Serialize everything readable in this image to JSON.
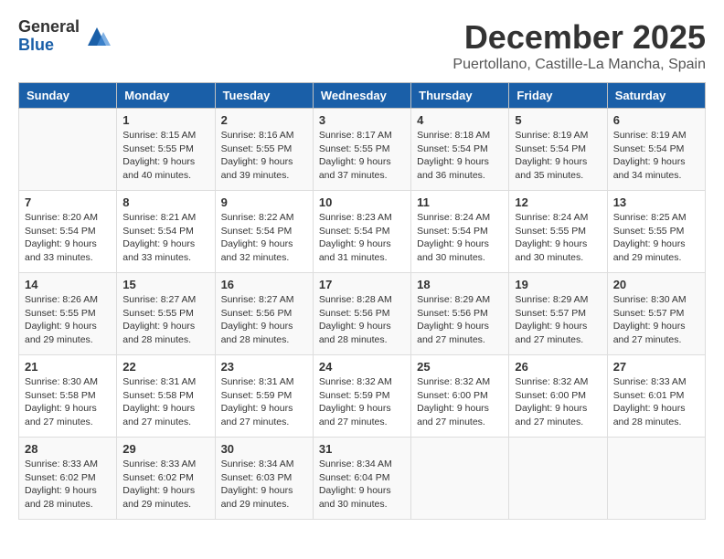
{
  "logo": {
    "general": "General",
    "blue": "Blue"
  },
  "title": "December 2025",
  "location": "Puertollano, Castille-La Mancha, Spain",
  "weekdays": [
    "Sunday",
    "Monday",
    "Tuesday",
    "Wednesday",
    "Thursday",
    "Friday",
    "Saturday"
  ],
  "weeks": [
    [
      {
        "day": "",
        "info": ""
      },
      {
        "day": "1",
        "info": "Sunrise: 8:15 AM\nSunset: 5:55 PM\nDaylight: 9 hours\nand 40 minutes."
      },
      {
        "day": "2",
        "info": "Sunrise: 8:16 AM\nSunset: 5:55 PM\nDaylight: 9 hours\nand 39 minutes."
      },
      {
        "day": "3",
        "info": "Sunrise: 8:17 AM\nSunset: 5:55 PM\nDaylight: 9 hours\nand 37 minutes."
      },
      {
        "day": "4",
        "info": "Sunrise: 8:18 AM\nSunset: 5:54 PM\nDaylight: 9 hours\nand 36 minutes."
      },
      {
        "day": "5",
        "info": "Sunrise: 8:19 AM\nSunset: 5:54 PM\nDaylight: 9 hours\nand 35 minutes."
      },
      {
        "day": "6",
        "info": "Sunrise: 8:19 AM\nSunset: 5:54 PM\nDaylight: 9 hours\nand 34 minutes."
      }
    ],
    [
      {
        "day": "7",
        "info": "Sunrise: 8:20 AM\nSunset: 5:54 PM\nDaylight: 9 hours\nand 33 minutes."
      },
      {
        "day": "8",
        "info": "Sunrise: 8:21 AM\nSunset: 5:54 PM\nDaylight: 9 hours\nand 33 minutes."
      },
      {
        "day": "9",
        "info": "Sunrise: 8:22 AM\nSunset: 5:54 PM\nDaylight: 9 hours\nand 32 minutes."
      },
      {
        "day": "10",
        "info": "Sunrise: 8:23 AM\nSunset: 5:54 PM\nDaylight: 9 hours\nand 31 minutes."
      },
      {
        "day": "11",
        "info": "Sunrise: 8:24 AM\nSunset: 5:54 PM\nDaylight: 9 hours\nand 30 minutes."
      },
      {
        "day": "12",
        "info": "Sunrise: 8:24 AM\nSunset: 5:55 PM\nDaylight: 9 hours\nand 30 minutes."
      },
      {
        "day": "13",
        "info": "Sunrise: 8:25 AM\nSunset: 5:55 PM\nDaylight: 9 hours\nand 29 minutes."
      }
    ],
    [
      {
        "day": "14",
        "info": "Sunrise: 8:26 AM\nSunset: 5:55 PM\nDaylight: 9 hours\nand 29 minutes."
      },
      {
        "day": "15",
        "info": "Sunrise: 8:27 AM\nSunset: 5:55 PM\nDaylight: 9 hours\nand 28 minutes."
      },
      {
        "day": "16",
        "info": "Sunrise: 8:27 AM\nSunset: 5:56 PM\nDaylight: 9 hours\nand 28 minutes."
      },
      {
        "day": "17",
        "info": "Sunrise: 8:28 AM\nSunset: 5:56 PM\nDaylight: 9 hours\nand 28 minutes."
      },
      {
        "day": "18",
        "info": "Sunrise: 8:29 AM\nSunset: 5:56 PM\nDaylight: 9 hours\nand 27 minutes."
      },
      {
        "day": "19",
        "info": "Sunrise: 8:29 AM\nSunset: 5:57 PM\nDaylight: 9 hours\nand 27 minutes."
      },
      {
        "day": "20",
        "info": "Sunrise: 8:30 AM\nSunset: 5:57 PM\nDaylight: 9 hours\nand 27 minutes."
      }
    ],
    [
      {
        "day": "21",
        "info": "Sunrise: 8:30 AM\nSunset: 5:58 PM\nDaylight: 9 hours\nand 27 minutes."
      },
      {
        "day": "22",
        "info": "Sunrise: 8:31 AM\nSunset: 5:58 PM\nDaylight: 9 hours\nand 27 minutes."
      },
      {
        "day": "23",
        "info": "Sunrise: 8:31 AM\nSunset: 5:59 PM\nDaylight: 9 hours\nand 27 minutes."
      },
      {
        "day": "24",
        "info": "Sunrise: 8:32 AM\nSunset: 5:59 PM\nDaylight: 9 hours\nand 27 minutes."
      },
      {
        "day": "25",
        "info": "Sunrise: 8:32 AM\nSunset: 6:00 PM\nDaylight: 9 hours\nand 27 minutes."
      },
      {
        "day": "26",
        "info": "Sunrise: 8:32 AM\nSunset: 6:00 PM\nDaylight: 9 hours\nand 27 minutes."
      },
      {
        "day": "27",
        "info": "Sunrise: 8:33 AM\nSunset: 6:01 PM\nDaylight: 9 hours\nand 28 minutes."
      }
    ],
    [
      {
        "day": "28",
        "info": "Sunrise: 8:33 AM\nSunset: 6:02 PM\nDaylight: 9 hours\nand 28 minutes."
      },
      {
        "day": "29",
        "info": "Sunrise: 8:33 AM\nSunset: 6:02 PM\nDaylight: 9 hours\nand 29 minutes."
      },
      {
        "day": "30",
        "info": "Sunrise: 8:34 AM\nSunset: 6:03 PM\nDaylight: 9 hours\nand 29 minutes."
      },
      {
        "day": "31",
        "info": "Sunrise: 8:34 AM\nSunset: 6:04 PM\nDaylight: 9 hours\nand 30 minutes."
      },
      {
        "day": "",
        "info": ""
      },
      {
        "day": "",
        "info": ""
      },
      {
        "day": "",
        "info": ""
      }
    ]
  ]
}
